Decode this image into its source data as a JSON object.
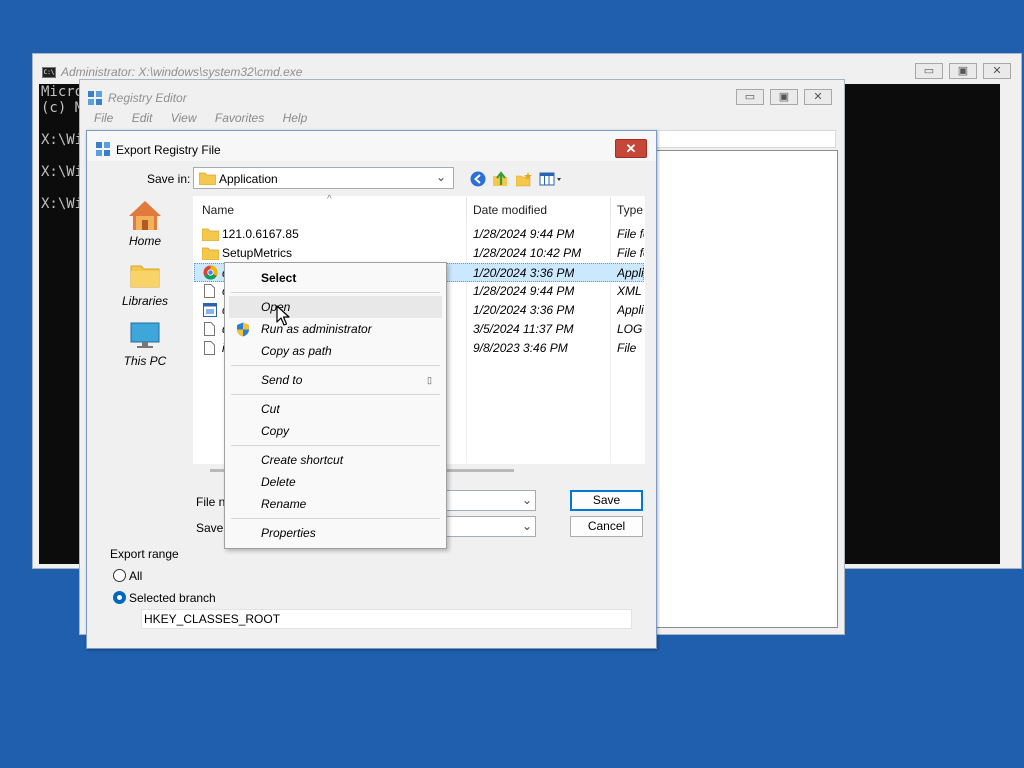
{
  "cmd": {
    "title": "Administrator: X:\\windows\\system32\\cmd.exe",
    "icon_text": "C:\\",
    "lines": [
      "Micro",
      "(c) M",
      "X:\\Wi",
      "X:\\Wi",
      "X:\\Wi"
    ]
  },
  "regedit": {
    "title": "Registry Editor",
    "menu": [
      "File",
      "Edit",
      "View",
      "Favorites",
      "Help"
    ]
  },
  "window_buttons": {
    "minimize": "▭",
    "maximize": "▣",
    "close": "✕"
  },
  "dialog": {
    "title": "Export Registry File",
    "close_glyph": "✕",
    "save_in_label": "Save in:",
    "save_in_value": "Application",
    "places": [
      {
        "label": "Home",
        "icon": "home-icon"
      },
      {
        "label": "Libraries",
        "icon": "libraries-icon"
      },
      {
        "label": "This PC",
        "icon": "this-pc-icon"
      }
    ],
    "columns": [
      "Name",
      "Date modified",
      "Type"
    ],
    "files": [
      {
        "name": "121.0.6167.85",
        "date": "1/28/2024 9:44 PM",
        "type": "File fo",
        "icon": "folder-icon"
      },
      {
        "name": "SetupMetrics",
        "date": "1/28/2024 10:42 PM",
        "type": "File fo",
        "icon": "folder-icon"
      },
      {
        "name": "c",
        "date": "1/20/2024 3:36 PM",
        "type": "Appli",
        "icon": "chrome-icon"
      },
      {
        "name": "c",
        "date": "1/28/2024 9:44 PM",
        "type": "XML",
        "icon": "document-icon"
      },
      {
        "name": "c",
        "date": "1/20/2024 3:36 PM",
        "type": "Appli",
        "icon": "app-icon"
      },
      {
        "name": "d",
        "date": "3/5/2024 11:37 PM",
        "type": "LOG",
        "icon": "document-icon"
      },
      {
        "name": "i",
        "date": "9/8/2023 3:46 PM",
        "type": "File",
        "icon": "document-icon"
      }
    ],
    "file_name_label": "File na",
    "save_as_label": "Save",
    "save_button": "Save",
    "cancel_button": "Cancel",
    "export_range_label": "Export range",
    "radio_all": "All",
    "radio_selected": "Selected branch",
    "branch_value": "HKEY_CLASSES_ROOT"
  },
  "context_menu": {
    "items": [
      {
        "label": "Select",
        "bold": true
      },
      {
        "label": "Open",
        "hover": true
      },
      {
        "label": "Run as administrator",
        "icon": "shield-icon"
      },
      {
        "label": "Copy as path"
      },
      {
        "label": "Send to",
        "submenu": true
      },
      {
        "label": "Cut"
      },
      {
        "label": "Copy"
      },
      {
        "label": "Create shortcut"
      },
      {
        "label": "Delete"
      },
      {
        "label": "Rename"
      },
      {
        "label": "Properties"
      }
    ],
    "submenu_glyph": "▯"
  },
  "colors": {
    "desktop": "#1f5fae",
    "selection": "#cce8ff",
    "accent": "#0078d7",
    "close_red": "#c7463a"
  }
}
